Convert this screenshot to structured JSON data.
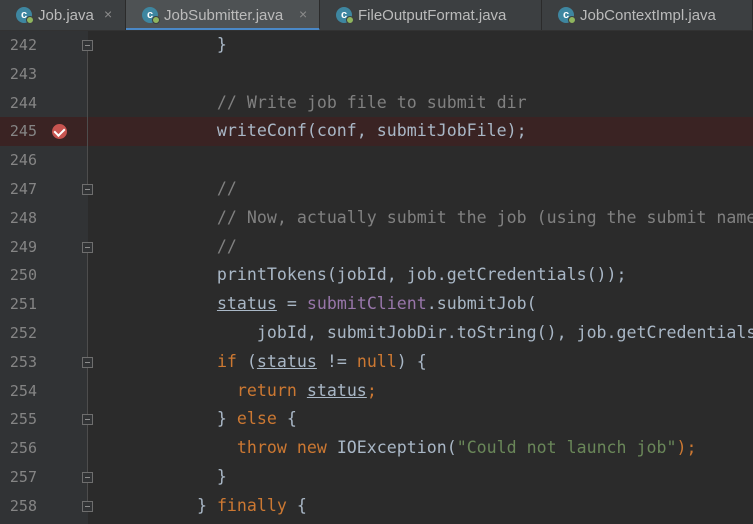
{
  "tabs": [
    {
      "label": "Job.java",
      "active": false
    },
    {
      "label": "JobSubmitter.java",
      "active": true
    },
    {
      "label": "FileOutputFormat.java",
      "active": false
    },
    {
      "label": "JobContextImpl.java",
      "active": false
    }
  ],
  "tab_icon": "class-icon",
  "tab_icon_letter": "c",
  "tab_close_glyph": "×",
  "breakpoint_icon": "breakpoint-verified-icon",
  "lines": [
    {
      "num": "242",
      "segments": [
        {
          "t": "        }",
          "c": "plain"
        }
      ]
    },
    {
      "num": "243",
      "segments": []
    },
    {
      "num": "244",
      "segments": [
        {
          "t": "        // Write job file to submit dir",
          "c": "cm"
        }
      ]
    },
    {
      "num": "245",
      "breakpoint": true,
      "segments": [
        {
          "t": "        writeConf(conf, submitJobFile);",
          "c": "plain"
        }
      ]
    },
    {
      "num": "246",
      "segments": []
    },
    {
      "num": "247",
      "segments": [
        {
          "t": "        //",
          "c": "cm"
        }
      ]
    },
    {
      "num": "248",
      "segments": [
        {
          "t": "        // Now, actually submit the job (using the submit name)",
          "c": "cm"
        }
      ]
    },
    {
      "num": "249",
      "segments": [
        {
          "t": "        //",
          "c": "cm"
        }
      ]
    },
    {
      "num": "250",
      "segments": [
        {
          "t": "        printTokens(jobId, job.getCredentials());",
          "c": "plain"
        }
      ]
    },
    {
      "num": "251",
      "segments": [
        {
          "t": "        ",
          "c": "plain"
        },
        {
          "t": "status",
          "c": "plain ul"
        },
        {
          "t": " = ",
          "c": "plain"
        },
        {
          "t": "submitClient",
          "c": "fld"
        },
        {
          "t": ".submitJob(",
          "c": "plain"
        }
      ]
    },
    {
      "num": "252",
      "segments": [
        {
          "t": "            jobId, submitJobDir.toString(), job.getCredentials());",
          "c": "plain"
        }
      ]
    },
    {
      "num": "253",
      "segments": [
        {
          "t": "        ",
          "c": "plain"
        },
        {
          "t": "if",
          "c": "kw"
        },
        {
          "t": " (",
          "c": "plain"
        },
        {
          "t": "status",
          "c": "plain ul"
        },
        {
          "t": " != ",
          "c": "plain"
        },
        {
          "t": "null",
          "c": "kw"
        },
        {
          "t": ") {",
          "c": "plain"
        }
      ]
    },
    {
      "num": "254",
      "segments": [
        {
          "t": "          ",
          "c": "plain"
        },
        {
          "t": "return",
          "c": "kw"
        },
        {
          "t": " ",
          "c": "plain"
        },
        {
          "t": "status",
          "c": "plain ul"
        },
        {
          "t": ";",
          "c": "kw"
        }
      ]
    },
    {
      "num": "255",
      "segments": [
        {
          "t": "        } ",
          "c": "plain"
        },
        {
          "t": "else",
          "c": "kw"
        },
        {
          "t": " {",
          "c": "plain"
        }
      ]
    },
    {
      "num": "256",
      "segments": [
        {
          "t": "          ",
          "c": "plain"
        },
        {
          "t": "throw new",
          "c": "kw"
        },
        {
          "t": " IOException(",
          "c": "plain"
        },
        {
          "t": "\"Could not launch job\"",
          "c": "str"
        },
        {
          "t": ");",
          "c": "kw"
        }
      ]
    },
    {
      "num": "257",
      "segments": [
        {
          "t": "        }",
          "c": "plain"
        }
      ]
    },
    {
      "num": "258",
      "segments": [
        {
          "t": "      } ",
          "c": "plain"
        },
        {
          "t": "finally",
          "c": "kw"
        },
        {
          "t": " {",
          "c": "plain"
        }
      ]
    }
  ]
}
